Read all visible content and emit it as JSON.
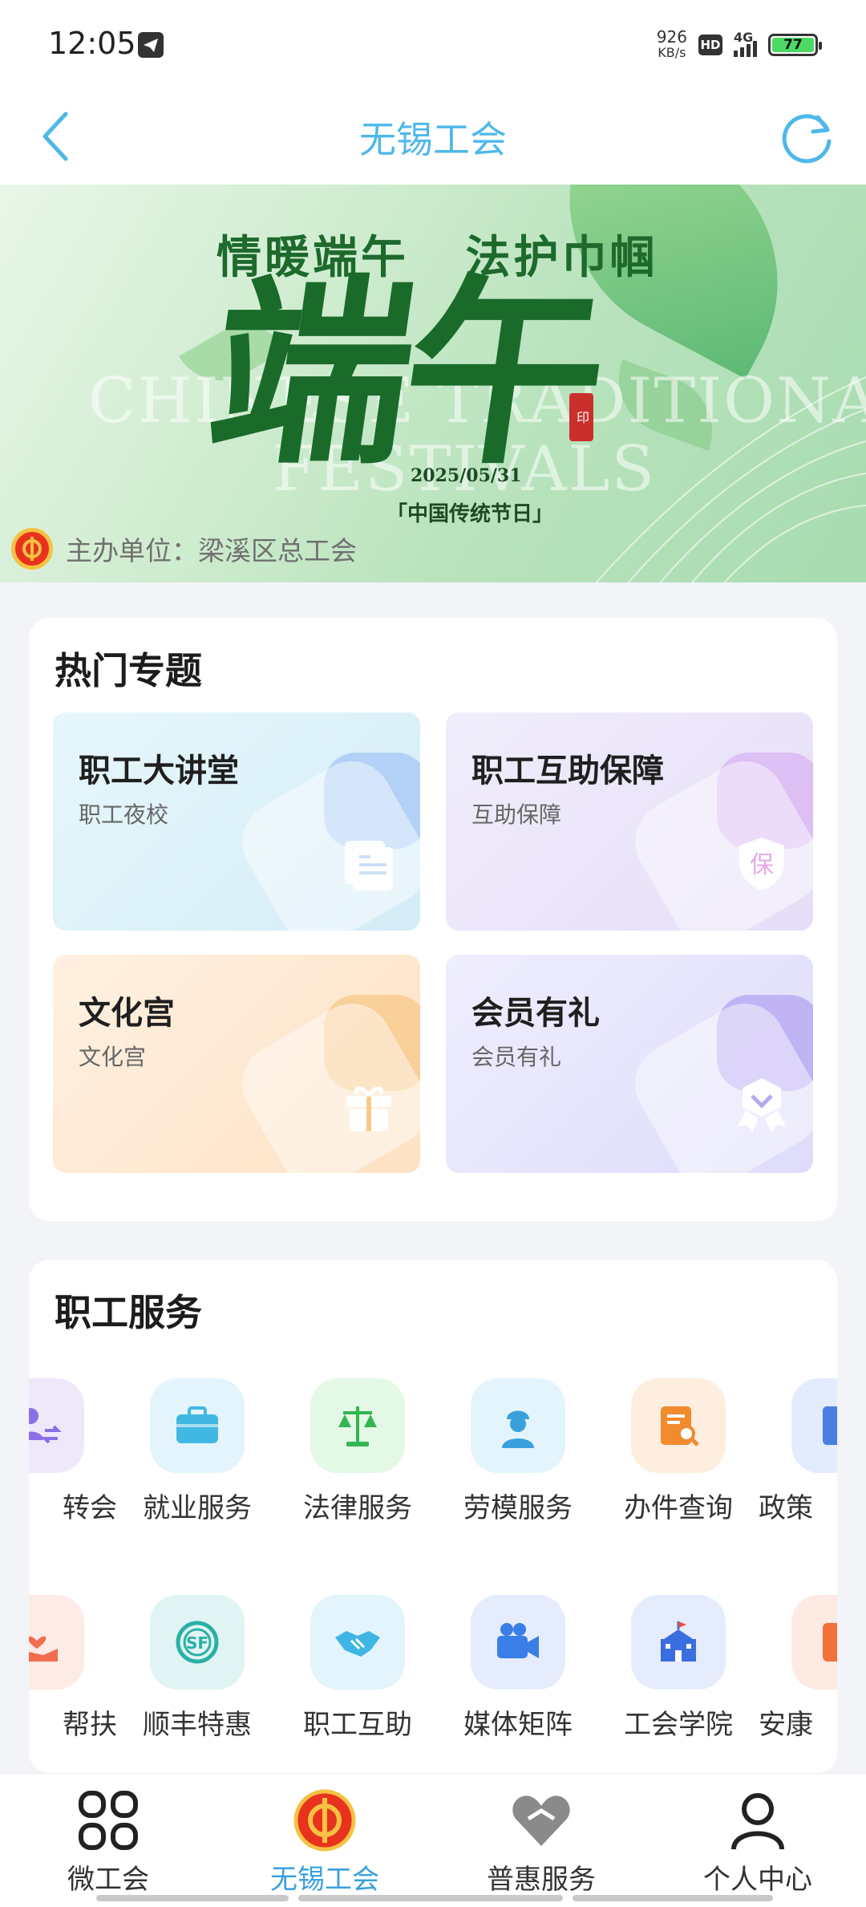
{
  "status_bar": {
    "time": "12:05",
    "net_speed_value": "926",
    "net_speed_unit": "KB/s",
    "hd": "HD",
    "network": "4G",
    "battery": "77"
  },
  "nav": {
    "title": "无锡工会",
    "back_icon": "chevron-left-icon",
    "refresh_icon": "refresh-icon"
  },
  "banner": {
    "slogan": "情暖端午   法护巾帼",
    "calligraphy": "端午",
    "bg_text_line1": "CHINESE TRADITIONAL",
    "bg_text_line2": "FESTIVALS",
    "date": "2025/05/31",
    "tagline": "「中国传统节日」",
    "host": "主办单位：梁溪区总工会"
  },
  "hot_topics": {
    "title": "热门专题",
    "items": [
      {
        "title": "职工大讲堂",
        "subtitle": "职工夜校",
        "icon": "document-icon"
      },
      {
        "title": "职工互助保障",
        "subtitle": "互助保障",
        "icon": "shield-bao-icon"
      },
      {
        "title": "文化宫",
        "subtitle": "文化宫",
        "icon": "gift-icon"
      },
      {
        "title": "会员有礼",
        "subtitle": "会员有礼",
        "icon": "badge-icon"
      }
    ]
  },
  "services": {
    "title": "职工服务",
    "row1": [
      {
        "label": "转会",
        "icon": "transfer-icon"
      },
      {
        "label": "就业服务",
        "icon": "briefcase-icon"
      },
      {
        "label": "法律服务",
        "icon": "scales-icon"
      },
      {
        "label": "劳模服务",
        "icon": "worker-icon"
      },
      {
        "label": "办件查询",
        "icon": "document-search-icon"
      },
      {
        "label": "政策",
        "icon": "policy-icon"
      }
    ],
    "row2": [
      {
        "label": "帮扶",
        "icon": "helping-hand-icon"
      },
      {
        "label": "顺丰特惠",
        "icon": "sf-icon"
      },
      {
        "label": "职工互助",
        "icon": "handshake-icon"
      },
      {
        "label": "媒体矩阵",
        "icon": "video-camera-icon"
      },
      {
        "label": "工会学院",
        "icon": "school-icon"
      },
      {
        "label": "安康",
        "icon": "safety-icon"
      }
    ]
  },
  "tabs": [
    {
      "label": "微工会",
      "icon": "grid-icon"
    },
    {
      "label": "无锡工会",
      "icon": "union-logo-icon",
      "active": true
    },
    {
      "label": "普惠服务",
      "icon": "heart-icon"
    },
    {
      "label": "个人中心",
      "icon": "person-icon"
    }
  ],
  "colors": {
    "accent": "#4fb8e9",
    "active_tab": "#3aa0dc",
    "banner_green": "#1a6b2a"
  }
}
